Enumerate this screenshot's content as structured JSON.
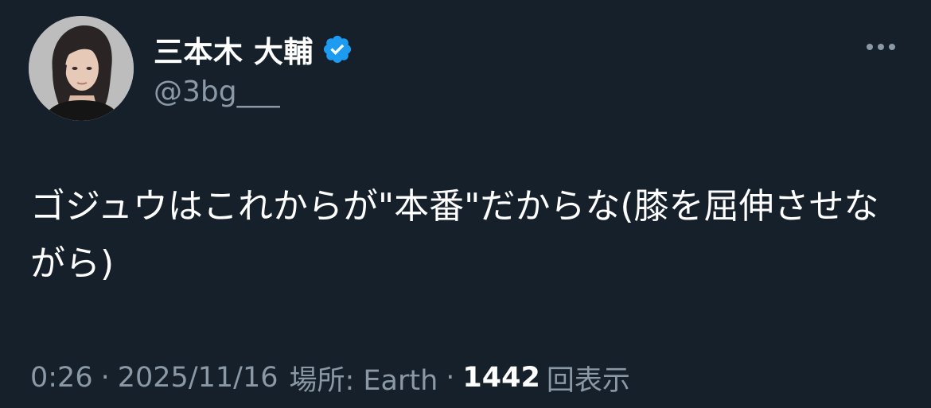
{
  "author": {
    "display_name": "三本木 大輔",
    "handle": "@3bg___",
    "verified": true
  },
  "tweet": {
    "text": "ゴジュウはこれからが\"本番\"だからな(膝を屈伸させながら)"
  },
  "meta": {
    "time": "0:26",
    "separator": "·",
    "date": "2025/11/16",
    "location": "場所: Earth",
    "views_count": "1442",
    "views_label": "回表示"
  },
  "colors": {
    "background": "#15202b",
    "primary_text": "#ffffff",
    "secondary_text": "#8b98a5",
    "verified_badge": "#1d9bf0"
  },
  "icons": {
    "verified": "verified-badge-icon",
    "more": "more-options-icon"
  }
}
